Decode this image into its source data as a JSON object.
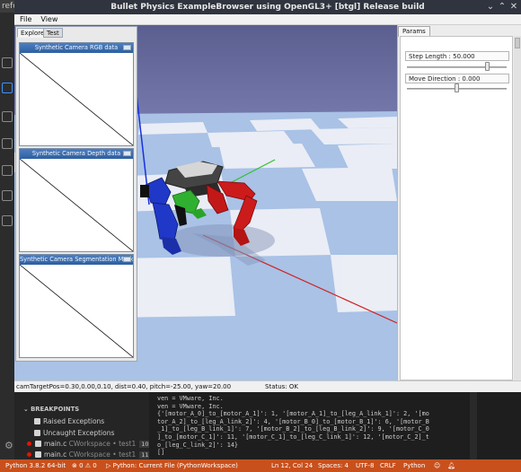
{
  "vscode": {
    "title_fragment": "refc",
    "breakpoints": {
      "header": "BREAKPOINTS",
      "items": [
        {
          "label": "Raised Exceptions",
          "checked": true
        },
        {
          "label": "Uncaught Exceptions",
          "checked": true
        },
        {
          "label": "main.c",
          "sub": "CWorkspace • test1",
          "line": "10"
        },
        {
          "label": "main.c",
          "sub": "CWorkspace • test1",
          "line": "11"
        }
      ]
    },
    "terminal_lines": [
      "ven = VMware, Inc.",
      "ven = VMware, Inc.",
      "{'[motor_A_0]_to_[motor_A_1]': 1, '[motor_A_1]_to_[leg_A_link_1]': 2, '[mo",
      "tor_A_2]_to_[leg_A_link_2]': 4, '[motor_B_0]_to_[motor_B_1]': 6, '[motor_B",
      "_1]_to_[leg_B_link_1]': 7, '[motor_B_2]_to_[leg_B_link_2]': 9, '[motor_C_0",
      "]_to_[motor_C_1]': 11, '[motor_C_1]_to_[leg_C_link_1]': 12, '[motor_C_2]_t",
      "o_[leg_C_link_2]': 14}",
      "[]"
    ],
    "statusbar": {
      "python_version": "Python 3.8.2 64-bit",
      "problems": "⊗ 0 ⚠ 0",
      "run_config": "▷ Python: Current File (PythonWorkspace)",
      "cursor": "Ln 12, Col 24",
      "spaces": "Spaces: 4",
      "encoding": "UTF-8",
      "eol": "CRLF",
      "language": "Python"
    }
  },
  "bullet": {
    "title": "Bullet Physics ExampleBrowser using OpenGL3+ [btgl] Release build",
    "menu": [
      "File",
      "View"
    ],
    "explorer_tabs": [
      "Explorer",
      "Test"
    ],
    "camera_panels": [
      "Synthetic Camera RGB data",
      "Synthetic Camera Depth data",
      "Synthetic Camera Segmentation Mask"
    ],
    "params_tab": "Params",
    "params": [
      {
        "label": "Step Length : 50.000",
        "value": 0.82
      },
      {
        "label": "Move Direction : 0.000",
        "value": 0.5
      }
    ],
    "status_left": "camTargetPos=0.30,0.00,0.10, dist=0.40, pitch=-25.00, yaw=20.00",
    "status_right": "Status: OK"
  },
  "colors": {
    "statusbar": "#c8501c",
    "sky_top": "#5b5f90",
    "sky_bottom": "#c8ccf0",
    "floor_blue": "#a9c2e6",
    "floor_white": "#eef0f6",
    "leg_red": "#cc1b1b",
    "leg_blue": "#2038c8",
    "leg_green": "#30b030"
  }
}
